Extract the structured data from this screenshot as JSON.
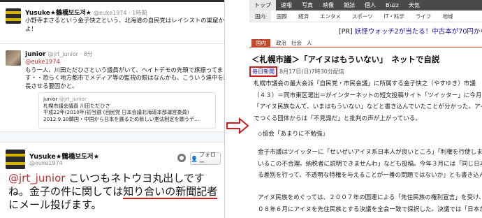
{
  "colors": {
    "accent_red": "#d21c1c",
    "yahoo_cat": "#c14a2d",
    "link": "#1a0dab"
  },
  "tweets": [
    {
      "name": "Yusuke★鶴橋보도저★",
      "handle": "@euke1974 · 1時間",
      "lines": [
        "小野寺まさるという金子快之という、北海道の自民党はレイシストの巣窟か",
        "よ！"
      ]
    },
    {
      "name": "junior",
      "handle": "@jrt_junior · 8分",
      "reply_to": "@euke1974",
      "lines": [
        "もう一人、川田ただひさという議員がいて、ヘイトデモの先頭で旗振ってま",
        "す・・恐らく地方都市でメディア等の監視の眼はなんかも、こういう連中を助",
        "長させる要因かと。"
      ],
      "quote": {
        "name": "junior",
        "handle": "@jrt_junior",
        "lines": [
          "札幌市議会議員 川田ただひさ",
          "平成22年(2010年)初当選 (自民党 日本会議北海道本部運営委員)",
          "2012.9.30韓国・中国から日本を護るため新しい憲法制定を願うデ..."
        ]
      }
    }
  ],
  "big_tweet": {
    "name": "Yusuke★鶴橋보도저★",
    "handle": "@euke1974",
    "follow_label": "フォロー",
    "mention": "@jrt_junior",
    "line1_rest": " こいつもネトウヨ丸出しです",
    "line2_pre": "ね。金子の件に関しては",
    "line2_underlined": "知り合いの新聞記者",
    "line3": "にメール投げます。"
  },
  "nav_main": [
    "トップ",
    "速報",
    "写真",
    "映像",
    "雑誌",
    "個人",
    "Buzz",
    "天気"
  ],
  "nav_sub": [
    "国内",
    "国際",
    "経済",
    "エンタメ",
    "スポーツ",
    "IT・科学",
    "ライフ",
    "地域"
  ],
  "ad": {
    "pr": "[PR]",
    "text": "妖怪ウォッチ2が当たる！中古本が70円から！ブック"
  },
  "categories": [
    "国内",
    "政治",
    "社会",
    "人"
  ],
  "article": {
    "headline": "＜札幌市議＞「アイヌはもういない」　ネットで自説",
    "source_tag": "毎日新聞",
    "date": "8月17日(日)7時30分配信",
    "paragraphs": [
      "札幌市議会の最大会派「自民党・市民会議」に所属する金子快之（やすゆき）市議",
      "（４３）＝同市東区選出＝がインターネットの短文投稿サイト「ツイッター」に今月１１日",
      "「アイヌ民族なんて、いまはもういない」などと書き込んでいたことが分かった。アイヌ民",
      "でつくる団体からは「不見識だ」と批判の声が上がっている。",
      "◇協会「あまりに不勉強」",
      "金子市議はツイッターに「せいぜいアイヌ系日本人が良いところ」「利権を行使しまくって",
      "いるこの不合理。納税者に説明できませんわ」なども投稿。今年３月には「同じ日本人に対",
      "る差別を行って、不透明な特権を与えることが一番の問題ではないか」とも書き込んでいた",
      "アイヌ民族をめぐっては、２００７年の国連による「先住民族の権利宣言」を受け、国会が",
      "０８年６月にアイヌを先住民族とする決議を全会一致で採択した。決議では「日本が近代化"
    ]
  }
}
